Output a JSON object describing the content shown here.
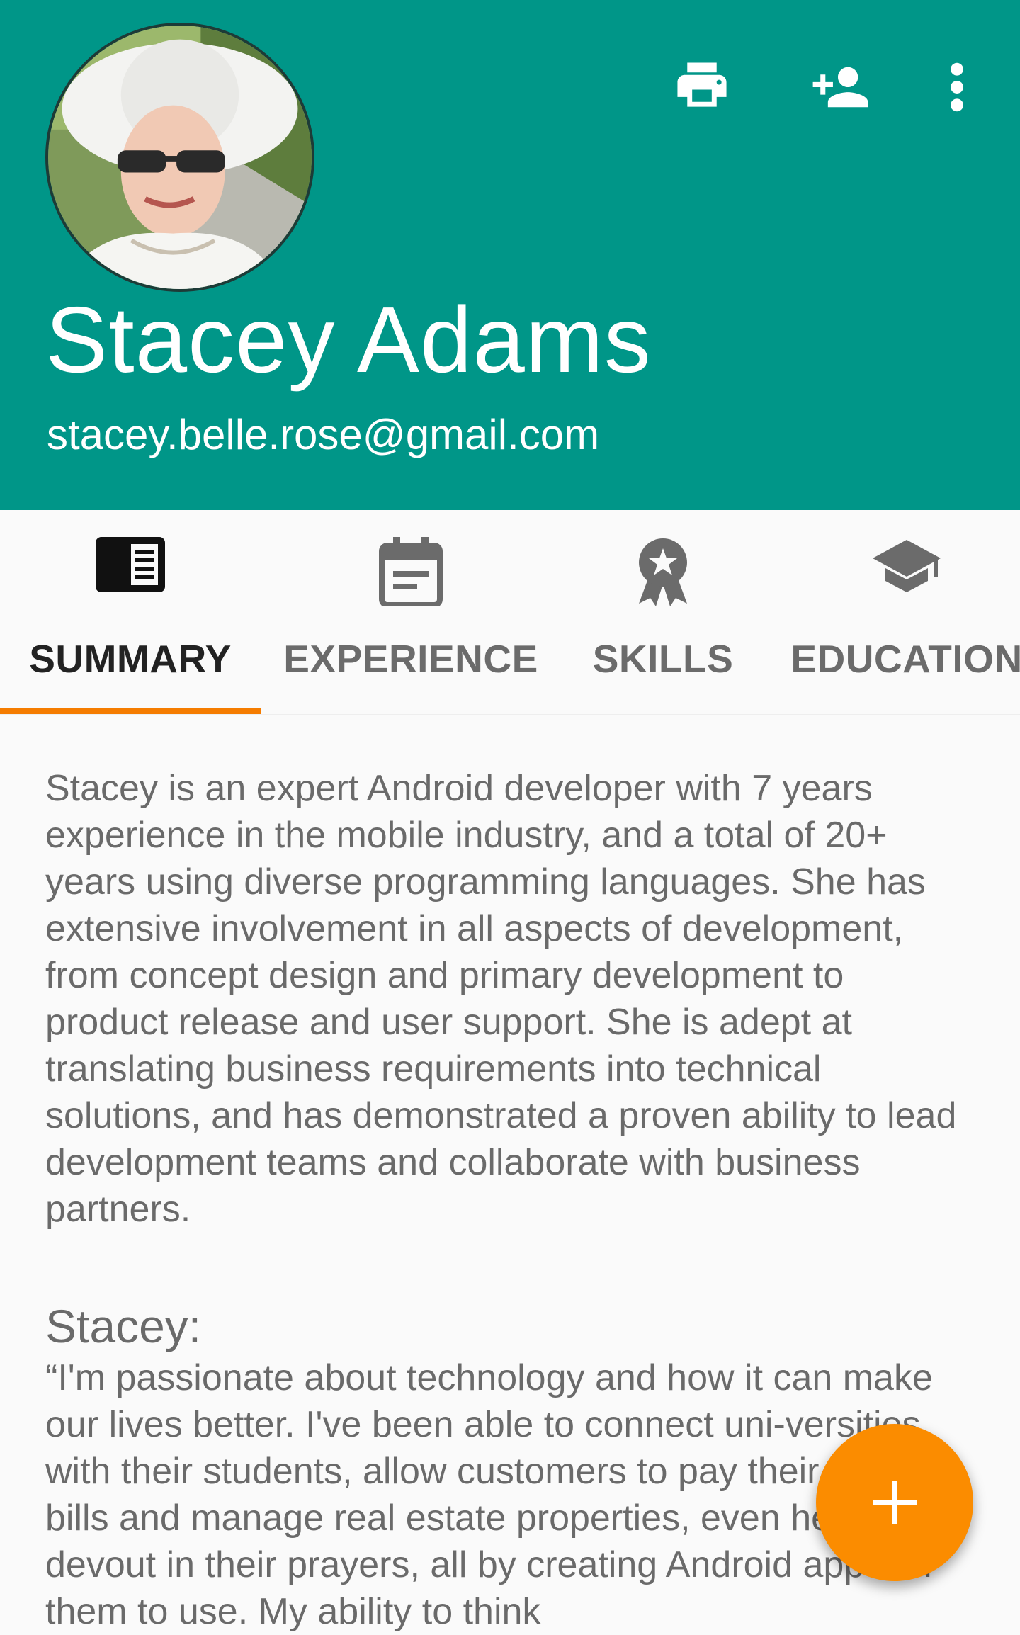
{
  "profile": {
    "name": "Stacey Adams",
    "email": "stacey.belle.rose@gmail.com"
  },
  "toolbar": {
    "actions": [
      {
        "icon": "printer-icon"
      },
      {
        "icon": "add-person-icon"
      },
      {
        "icon": "more-vert-icon"
      }
    ]
  },
  "tabs": [
    {
      "label": "SUMMARY",
      "icon": "summary-icon",
      "active": true
    },
    {
      "label": "EXPERIENCE",
      "icon": "calendar-icon",
      "active": false
    },
    {
      "label": "SKILLS",
      "icon": "award-icon",
      "active": false
    },
    {
      "label": "EDUCATION",
      "icon": "graduation-cap-icon",
      "active": false
    }
  ],
  "summary": {
    "paragraph": "Stacey is an expert Android developer with 7 years experience in the mobile industry, and a total of 20+ years using diverse programming languages. She has extensive involvement in all aspects of development, from concept design and primary development to product release and user support. She is adept at translating business requirements into technical solutions, and has demonstrated a proven ability to lead development teams and collaborate with business partners.",
    "quote_heading": "Stacey:",
    "quote": "“I'm passionate about technology and how it can make our lives better. I've been able to connect uni-versities with their students, allow customers to pay their mobile bills and manage real estate properties, even help the devout in their prayers, all by creating Android apps for them to use. My ability to think"
  },
  "colors": {
    "primary": "#009688",
    "accent": "#fb8c00",
    "indicator": "#f57c00"
  }
}
